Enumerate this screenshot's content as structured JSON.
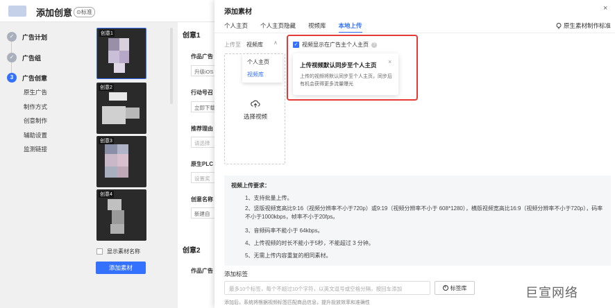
{
  "page": {
    "title": "添加创意",
    "badge": "⊙标准"
  },
  "sidebar": {
    "steps": [
      {
        "num": "✓",
        "label": "广告计划"
      },
      {
        "num": "✓",
        "label": "广告组"
      },
      {
        "num": "3",
        "label": "广告创意"
      }
    ],
    "subitems": [
      "原生广告",
      "制作方式",
      "创意制作",
      "辅助设置",
      "监测链接"
    ]
  },
  "thumbs": {
    "labels": [
      "创意1",
      "创意2",
      "创意3",
      "创意4"
    ],
    "show_name_label": "显示素材名称",
    "add_material_label": "添加素材"
  },
  "middle": {
    "creative1_title": "创意1",
    "fields": [
      {
        "label": "作品广告",
        "value": "升级iOS"
      },
      {
        "label": "行动号召",
        "value": "立即下载"
      },
      {
        "label": "推荐理由",
        "value": "请选择"
      },
      {
        "label": "原生PLC",
        "value": "设置奖"
      },
      {
        "label": "创意名称",
        "value": "新建自"
      }
    ],
    "creative2_title": "创意2",
    "creative2_field": "作品广告"
  },
  "modal": {
    "title": "添加素材",
    "close": "×",
    "tabs": [
      "个人主页",
      "个人主页隐藏",
      "视频库",
      "本地上传"
    ],
    "std_link": "原生素材制作标准",
    "upload_to_label": "上传至",
    "upload_to_value": "视频库",
    "dropdown": [
      "个人主页",
      "视频库"
    ],
    "show_on_homepage": "视频显示在广告主个人主页",
    "tooltip": {
      "title": "上传视频默认同步至个人主页",
      "close": "×",
      "body": "上传的视频将默认同步至个人主页，同步后有机会获得更多流量曝光"
    },
    "select_video": "选择视频",
    "requirements": {
      "title": "视频上传要求：",
      "items": [
        "1、支持批量上传。",
        "2、竖版视频宽高比9:16（视频分辨率不小于720p）或9:19（视频分辨率不小于 608*1280），横版视频宽高比16:9（视频分辨率不小于720p），码率不小于1000kbps，帧率不小于20fps。",
        "3、音频码率不能小于 64kbps。",
        "4、上传视频的时长不能小于5秒，不能超过 3 分钟。",
        "5、无需上传内容重复的相同素材。"
      ]
    },
    "tags": {
      "title": "添加标签",
      "placeholder": "最多10个标签，每个不超过10个字符，以英文逗号或空格分隔，按回车添加",
      "button": "标签库",
      "hint": "添加后，系统将根据视频标签匹配商品信息，提升投放效率和准确性"
    }
  },
  "watermark": "巨宣网络",
  "colors": {
    "accent": "#3471ff",
    "highlight": "#e53935"
  }
}
